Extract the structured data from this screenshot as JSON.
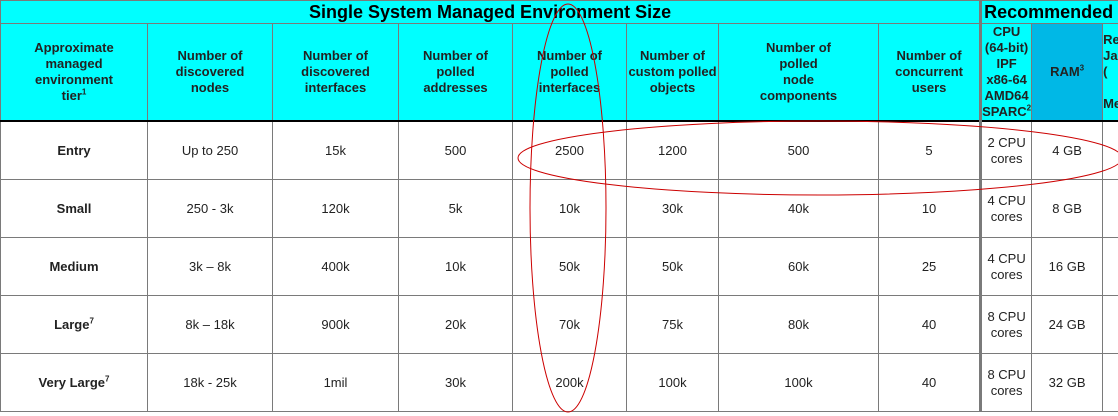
{
  "banner": {
    "main": "Single System Managed Environment Size",
    "recommended": "Recommended"
  },
  "headers": [
    {
      "lines": [
        "Approximate",
        "managed",
        "environment",
        "tier"
      ],
      "sup": "1"
    },
    {
      "lines": [
        "Number of",
        "discovered",
        "nodes"
      ],
      "sup": ""
    },
    {
      "lines": [
        "Number of",
        "discovered",
        "interfaces"
      ],
      "sup": ""
    },
    {
      "lines": [
        "Number of",
        "polled",
        "addresses"
      ],
      "sup": ""
    },
    {
      "lines": [
        "Number of",
        "polled",
        "interfaces"
      ],
      "sup": ""
    },
    {
      "lines": [
        "Number of",
        "custom polled",
        "objects"
      ],
      "sup": ""
    },
    {
      "lines": [
        "Number of",
        "polled",
        "node",
        "components"
      ],
      "sup": ""
    },
    {
      "lines": [
        "Number of",
        "concurrent",
        "users"
      ],
      "sup": ""
    },
    {
      "lines": [
        "CPU",
        "(64-bit)",
        "IPF",
        "x86-64",
        "AMD64",
        "SPARC"
      ],
      "sup": "2"
    },
    {
      "lines": [
        "RAM"
      ],
      "sup": "3"
    },
    {
      "lines": [
        "Re",
        "Ja",
        "(",
        "",
        "Me"
      ],
      "sup": ""
    }
  ],
  "rows": [
    {
      "tier": "Entry",
      "sup": "",
      "nodes": "Up to 250",
      "interfaces": "15k",
      "addresses": "500",
      "polled_interfaces": "2500",
      "custom": "1200",
      "components": "500",
      "users": "5",
      "cpu": [
        "2 CPU",
        "cores"
      ],
      "ram": "4 GB"
    },
    {
      "tier": "Small",
      "sup": "",
      "nodes": "250 - 3k",
      "interfaces": "120k",
      "addresses": "5k",
      "polled_interfaces": "10k",
      "custom": "30k",
      "components": "40k",
      "users": "10",
      "cpu": [
        "4 CPU",
        "cores"
      ],
      "ram": "8 GB"
    },
    {
      "tier": "Medium",
      "sup": "",
      "nodes": "3k – 8k",
      "interfaces": "400k",
      "addresses": "10k",
      "polled_interfaces": "50k",
      "custom": "50k",
      "components": "60k",
      "users": "25",
      "cpu": [
        "4 CPU",
        "cores"
      ],
      "ram": "16 GB"
    },
    {
      "tier": "Large",
      "sup": "7",
      "nodes": "8k – 18k",
      "interfaces": "900k",
      "addresses": "20k",
      "polled_interfaces": "70k",
      "custom": "75k",
      "components": "80k",
      "users": "40",
      "cpu": [
        "8 CPU",
        "cores"
      ],
      "ram": "24 GB"
    },
    {
      "tier": "Very Large",
      "sup": "7",
      "nodes": "18k - 25k",
      "interfaces": "1mil",
      "addresses": "30k",
      "polled_interfaces": "200k",
      "custom": "100k",
      "components": "100k",
      "users": "40",
      "cpu": [
        "8 CPU",
        "cores"
      ],
      "ram": "32 GB"
    }
  ],
  "colors": {
    "header_bg": "#00ffff",
    "ram_header_bg": "#00b8e6",
    "annotation": "#cc0000"
  }
}
